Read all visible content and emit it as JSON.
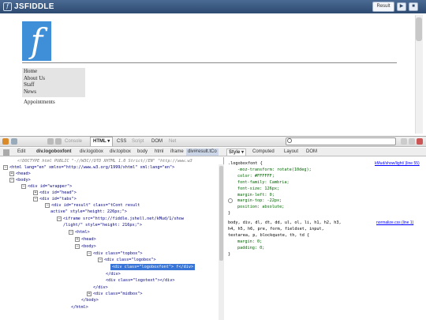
{
  "header": {
    "logo_text": "JSFIDDLE",
    "result_tab": "Result",
    "play_icon": "▶",
    "close_icon": "■"
  },
  "result": {
    "menu_items": [
      "Home",
      "About Us",
      "Staff",
      "News"
    ],
    "appointments": "Appointments"
  },
  "firebug": {
    "console_tab": "Console",
    "html_tab": "HTML ▾",
    "css_tab": "CSS",
    "script_tab": "Script",
    "dom_tab": "DOM",
    "net_tab": "Net",
    "edit_label": "Edit",
    "breadcrumbs": [
      "div.logoboxfont",
      "div.logobox",
      "div.topbox",
      "body",
      "html",
      "iframe",
      "div#result.tCo"
    ],
    "side_tabs": [
      "Style ▾",
      "Computed",
      "Layout",
      "DOM"
    ],
    "search_placeholder": ""
  },
  "html_lines": [
    "<!DOCTYPE html PUBLIC \"-//W3C//DTD XHTML 1.0 Strict//EN\" \"http://www.w3",
    "<html lang=\"en\" xmlns=\"http://www.w3.org/1999/xhtml\" xml:lang=\"en\">",
    "<head>",
    "<body>",
    "<div id=\"wrapper\">",
    "<div id=\"head\">",
    "<div id=\"tabs\">",
    "<div id=\"result\" class=\"tCont result",
    "active\" style=\"height: 226px;\">",
    "<iframe src=\"http://fiddle.jshell.net/kMud/1/show",
    "/light/\" style=\"height: 216px;\">",
    "<html>",
    "<head>",
    "<body>",
    "<div class=\"topbox\">",
    "<div class=\"logobox\">",
    "<div class=\"logoboxfont\"> f</div>",
    "</div>",
    "<div class=\"logotext\"></div>",
    "</div>",
    "<div class=\"midbox\">",
    "</body>",
    "</html>"
  ],
  "css": {
    "rule1_selector": ".logoboxfont {",
    "rule1_source": "kMud/show/light/ (line 55)",
    "rule1_props": [
      "-moz-transform: rotate(10deg);",
      "color: #FFFFFF;",
      "font-family: Cambria;",
      "font-size: 126px;",
      "margin-left: 0;",
      "margin-top: -22px;",
      "position: absolute;"
    ],
    "rule2_selector_a": "body, div, dl, dt, dd, ul, ol, li, h1, h2, h3,",
    "rule2_selector_b": "h4, h5, h6, pre, form, fieldset, input,",
    "rule2_selector_c": "textarea, p, blockquote, th, td {",
    "rule2_source": "normalize.css (line 1)",
    "rule2_props": [
      "margin: 0;",
      "padding: 0;"
    ],
    "close_brace": "}"
  }
}
